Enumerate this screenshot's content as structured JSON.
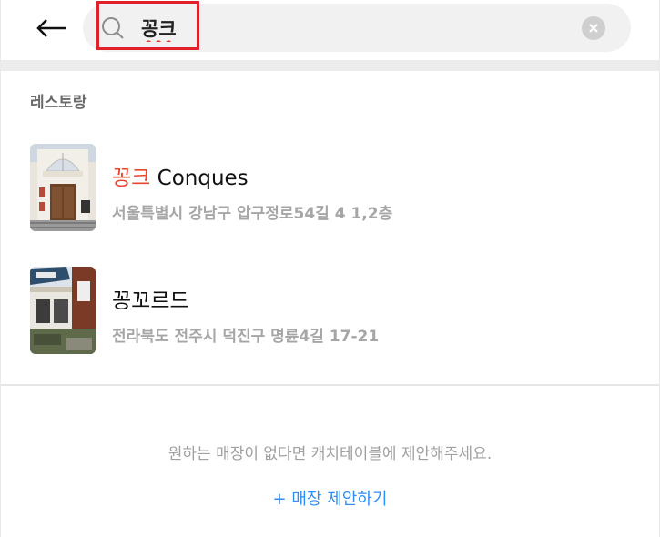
{
  "search": {
    "query": "꽁크",
    "placeholder": ""
  },
  "section": {
    "title": "레스토랑"
  },
  "results": [
    {
      "name_highlight": "꽁크",
      "name_rest": " Conques",
      "address": "서울특별시 강남구 압구정로54길 4 1,2층",
      "thumbnail_icon": "restaurant-storefront-photo"
    },
    {
      "name_highlight": "",
      "name_rest": "꽁꼬르드",
      "address": "전라북도 전주시 덕진구 명륜4길 17-21",
      "thumbnail_icon": "restaurant-storefront-photo"
    }
  ],
  "footer": {
    "hint": "원하는 매장이 없다면 캐치테이블에 제안해주세요.",
    "suggest_link": "+ 매장 제안하기"
  },
  "colors": {
    "highlight": "#e8472e",
    "link": "#2f8ef5",
    "annotation_box": "#e0212a"
  }
}
